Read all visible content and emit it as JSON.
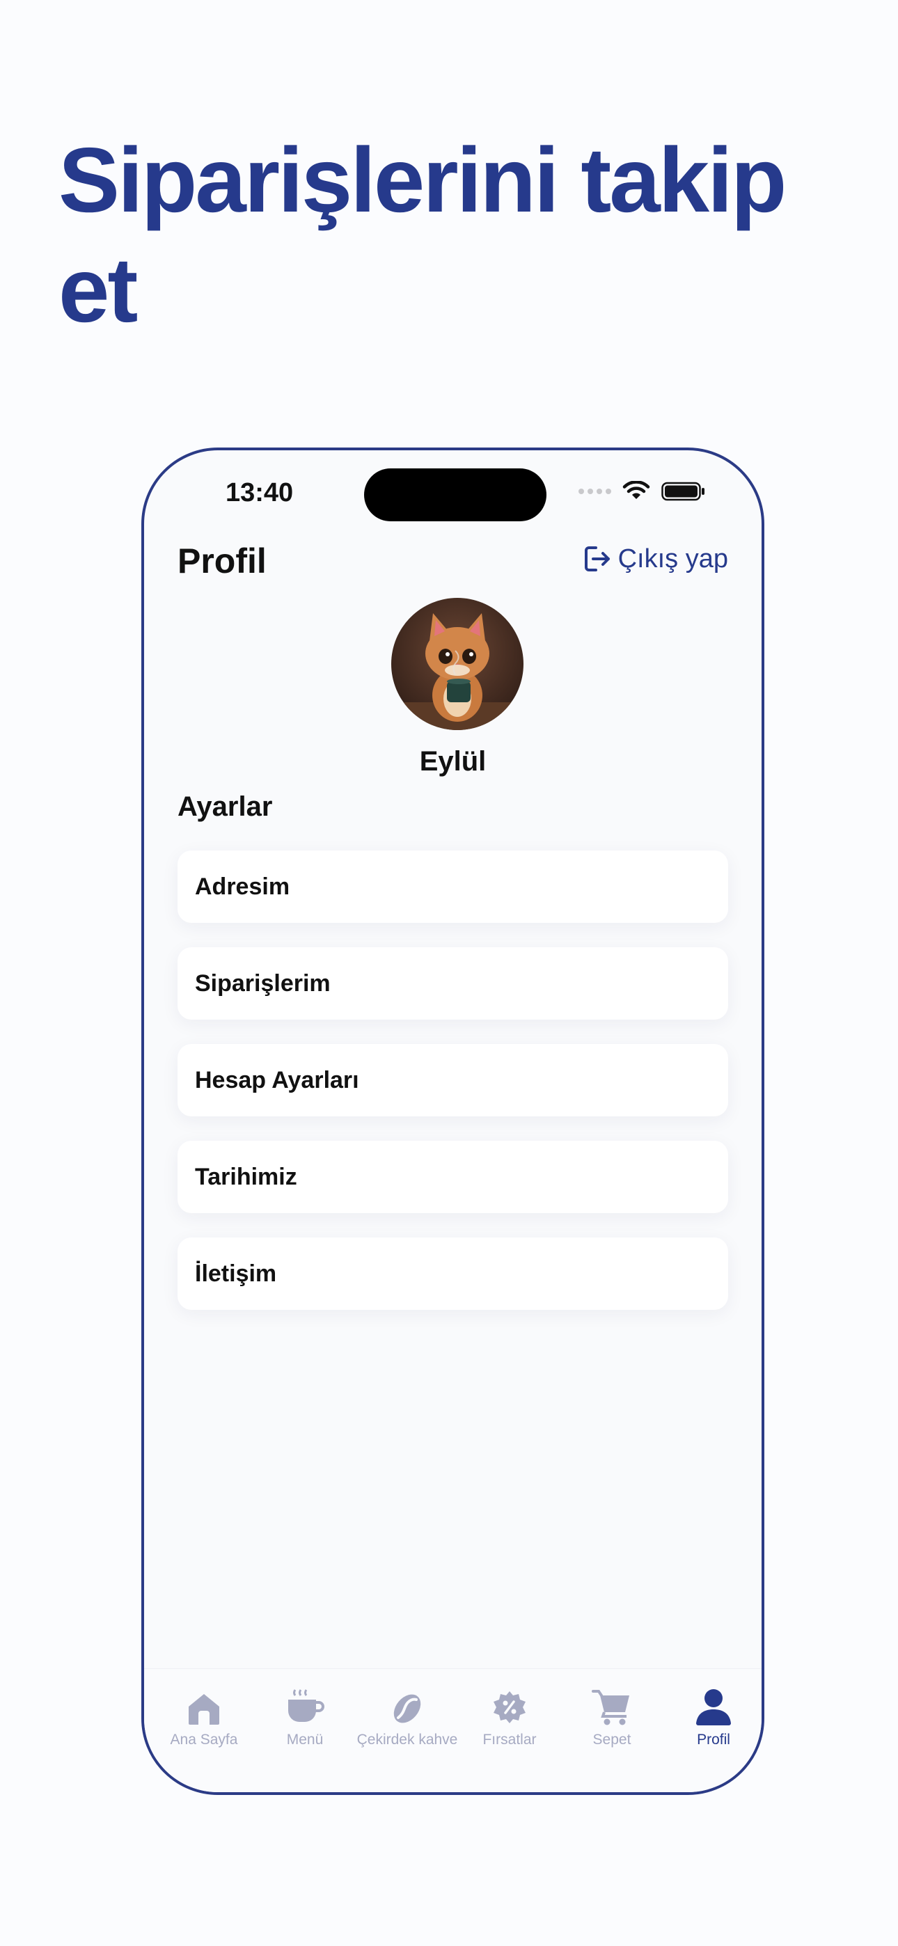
{
  "headline": "Siparişlerini takip et",
  "status": {
    "time": "13:40"
  },
  "header": {
    "title": "Profil",
    "logout_label": "Çıkış yap"
  },
  "profile": {
    "name": "Eylül"
  },
  "settings": {
    "title": "Ayarlar",
    "items": [
      {
        "label": "Adresim"
      },
      {
        "label": "Siparişlerim"
      },
      {
        "label": "Hesap Ayarları"
      },
      {
        "label": "Tarihimiz"
      },
      {
        "label": "İletişim"
      }
    ]
  },
  "tabbar": {
    "items": [
      {
        "label": "Ana Sayfa",
        "icon": "home-icon"
      },
      {
        "label": "Menü",
        "icon": "coffee-cup-icon"
      },
      {
        "label": "Çekirdek kahve",
        "icon": "coffee-bean-icon"
      },
      {
        "label": "Fırsatlar",
        "icon": "discount-icon"
      },
      {
        "label": "Sepet",
        "icon": "cart-icon"
      },
      {
        "label": "Profil",
        "icon": "user-icon"
      }
    ],
    "active": "Profil"
  },
  "colors": {
    "accent": "#263a8c",
    "inactive": "#a6aac2"
  }
}
